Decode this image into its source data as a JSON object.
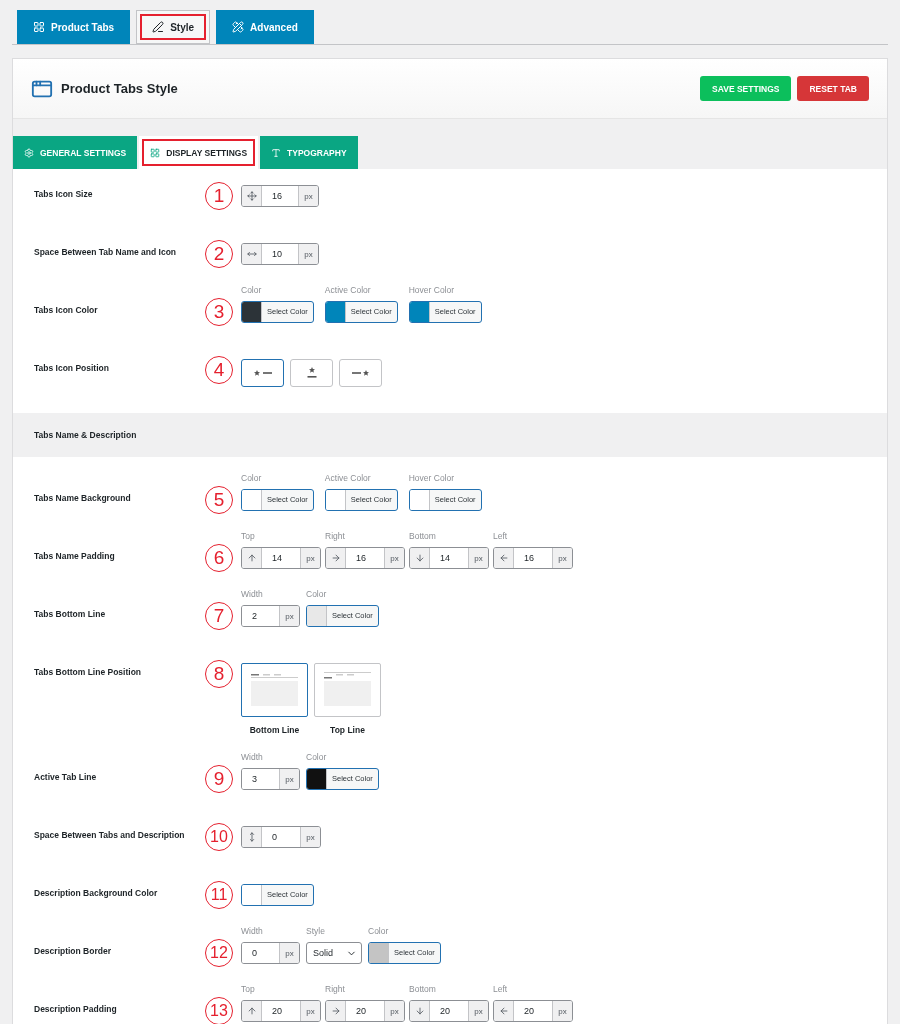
{
  "top_tabs": [
    {
      "label": "Product Tabs",
      "selected": false,
      "kind": "grid"
    },
    {
      "label": "Style",
      "selected": true,
      "kind": "pen"
    },
    {
      "label": "Advanced",
      "selected": false,
      "kind": "tools"
    }
  ],
  "panel": {
    "title": "Product Tabs Style",
    "buttons": [
      {
        "label": "SAVE SETTINGS",
        "kind": "save"
      },
      {
        "label": "RESET TAB",
        "kind": "reset"
      }
    ]
  },
  "sub_tabs": [
    {
      "label": "GENERAL SETTINGS",
      "selected": false,
      "kind": "gear"
    },
    {
      "label": "DISPLAY SETTINGS",
      "selected": true,
      "kind": "grid"
    },
    {
      "label": "TYPOGRAPHY",
      "selected": false,
      "kind": "type"
    }
  ],
  "rows": [
    {
      "kind": "setting",
      "label": "Tabs Icon Size",
      "callout": "1",
      "controls": [
        {
          "kind": "size_number",
          "value": "16",
          "unit": "px"
        }
      ]
    },
    {
      "kind": "setting",
      "label": "Space Between Tab Name and Icon",
      "callout": "2",
      "controls": [
        {
          "kind": "gap_number",
          "value": "10",
          "unit": "px"
        }
      ]
    },
    {
      "kind": "setting",
      "label": "Tabs Icon Color",
      "callout": "3",
      "controls": [
        {
          "kind": "color",
          "label": "Color",
          "color": "#2c3338",
          "button": "Select Color"
        },
        {
          "kind": "color",
          "label": "Active Color",
          "color": "#0085ba",
          "button": "Select Color"
        },
        {
          "kind": "color",
          "label": "Hover Color",
          "color": "#0085ba",
          "button": "Select Color"
        }
      ]
    },
    {
      "kind": "setting",
      "label": "Tabs Icon Position",
      "callout": "4",
      "controls": [
        {
          "kind": "icon_left",
          "selected": true
        },
        {
          "kind": "icon_top",
          "selected": false
        },
        {
          "kind": "icon_right",
          "selected": false
        }
      ]
    },
    {
      "kind": "section",
      "label": "Tabs Name & Description"
    },
    {
      "kind": "setting",
      "label": "Tabs Name Background",
      "callout": "5",
      "controls": [
        {
          "kind": "color",
          "label": "Color",
          "color": "#ffffff",
          "button": "Select Color"
        },
        {
          "kind": "color",
          "label": "Active Color",
          "color": "#ffffff",
          "button": "Select Color"
        },
        {
          "kind": "color",
          "label": "Hover Color",
          "color": "#ffffff",
          "button": "Select Color"
        }
      ]
    },
    {
      "kind": "setting",
      "label": "Tabs Name Padding",
      "callout": "6",
      "controls": [
        {
          "kind": "top_number",
          "label": "Top",
          "value": "14",
          "unit": "px"
        },
        {
          "kind": "right_number",
          "label": "Right",
          "value": "16",
          "unit": "px"
        },
        {
          "kind": "bottom_number",
          "label": "Bottom",
          "value": "14",
          "unit": "px"
        },
        {
          "kind": "left_number",
          "label": "Left",
          "value": "16",
          "unit": "px"
        }
      ]
    },
    {
      "kind": "setting",
      "label": "Tabs Bottom Line",
      "callout": "7",
      "controls": [
        {
          "kind": "width_number",
          "label": "Width",
          "value": "2",
          "unit": "px"
        },
        {
          "kind": "color",
          "label": "Color",
          "color": "#e8e8e8",
          "button": "Select Color"
        }
      ]
    },
    {
      "kind": "setting",
      "label": "Tabs Bottom Line Position",
      "callout": "8",
      "controls": [
        {
          "kind": "bottom_line",
          "caption": "Bottom Line",
          "selected": true
        },
        {
          "kind": "top_line",
          "caption": "Top Line",
          "selected": false
        }
      ]
    },
    {
      "kind": "setting",
      "label": "Active Tab Line",
      "callout": "9",
      "controls": [
        {
          "kind": "width_number",
          "label": "Width",
          "value": "3",
          "unit": "px"
        },
        {
          "kind": "color",
          "label": "Color",
          "color": "#111111",
          "button": "Select Color"
        }
      ]
    },
    {
      "kind": "setting",
      "label": "Space Between Tabs and Description",
      "callout": "10",
      "controls": [
        {
          "kind": "height_number",
          "value": "0",
          "unit": "px"
        }
      ]
    },
    {
      "kind": "setting",
      "label": "Description Background Color",
      "callout": "11",
      "controls": [
        {
          "kind": "color",
          "color": "#ffffff",
          "button": "Select Color"
        }
      ]
    },
    {
      "kind": "setting",
      "label": "Description Border",
      "callout": "12",
      "controls": [
        {
          "kind": "width_number",
          "label": "Width",
          "value": "0",
          "unit": "px"
        },
        {
          "kind": "select",
          "label": "Style",
          "value": "Solid"
        },
        {
          "kind": "color",
          "label": "Color",
          "color": "#c4c4c4",
          "button": "Select Color"
        }
      ]
    },
    {
      "kind": "setting",
      "label": "Description Padding",
      "callout": "13",
      "controls": [
        {
          "kind": "top_number",
          "label": "Top",
          "value": "20",
          "unit": "px"
        },
        {
          "kind": "right_number",
          "label": "Right",
          "value": "20",
          "unit": "px"
        },
        {
          "kind": "bottom_number",
          "label": "Bottom",
          "value": "20",
          "unit": "px"
        },
        {
          "kind": "left_number",
          "label": "Left",
          "value": "20",
          "unit": "px"
        }
      ]
    }
  ]
}
